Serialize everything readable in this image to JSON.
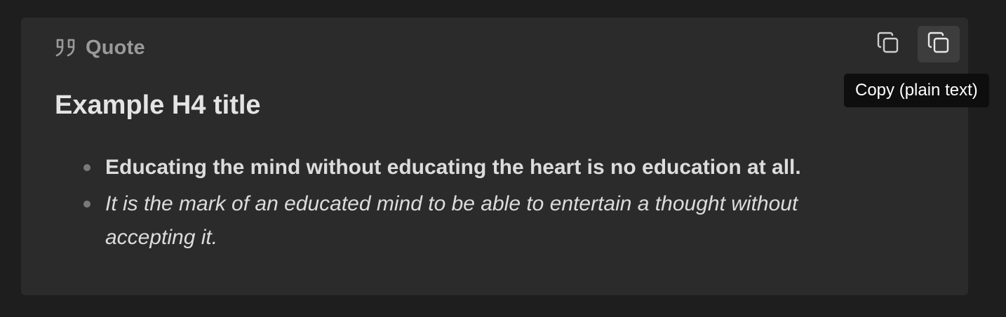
{
  "callout": {
    "label": "Quote",
    "icon": "quote-icon",
    "title": "Example H4 title",
    "quotes": [
      {
        "text": "Educating the mind without educating the heart is no education at all.",
        "style": "bold"
      },
      {
        "text": "It is the mark of an educated mind to be able to entertain a thought without accepting it.",
        "style": "italic"
      }
    ]
  },
  "toolbar": {
    "buttons": [
      {
        "icon": "copy-icon",
        "tooltip": ""
      },
      {
        "icon": "copy-icon",
        "tooltip": "Copy (plain text)"
      }
    ]
  },
  "tooltip": {
    "text": "Copy (plain text)"
  },
  "colors": {
    "page_bg": "#1e1e1e",
    "callout_bg": "#2b2b2b",
    "label": "#9a9a9a",
    "title": "#e4e4e4",
    "text": "#dcdcdc",
    "tooltip_bg": "#0e0e0e"
  }
}
